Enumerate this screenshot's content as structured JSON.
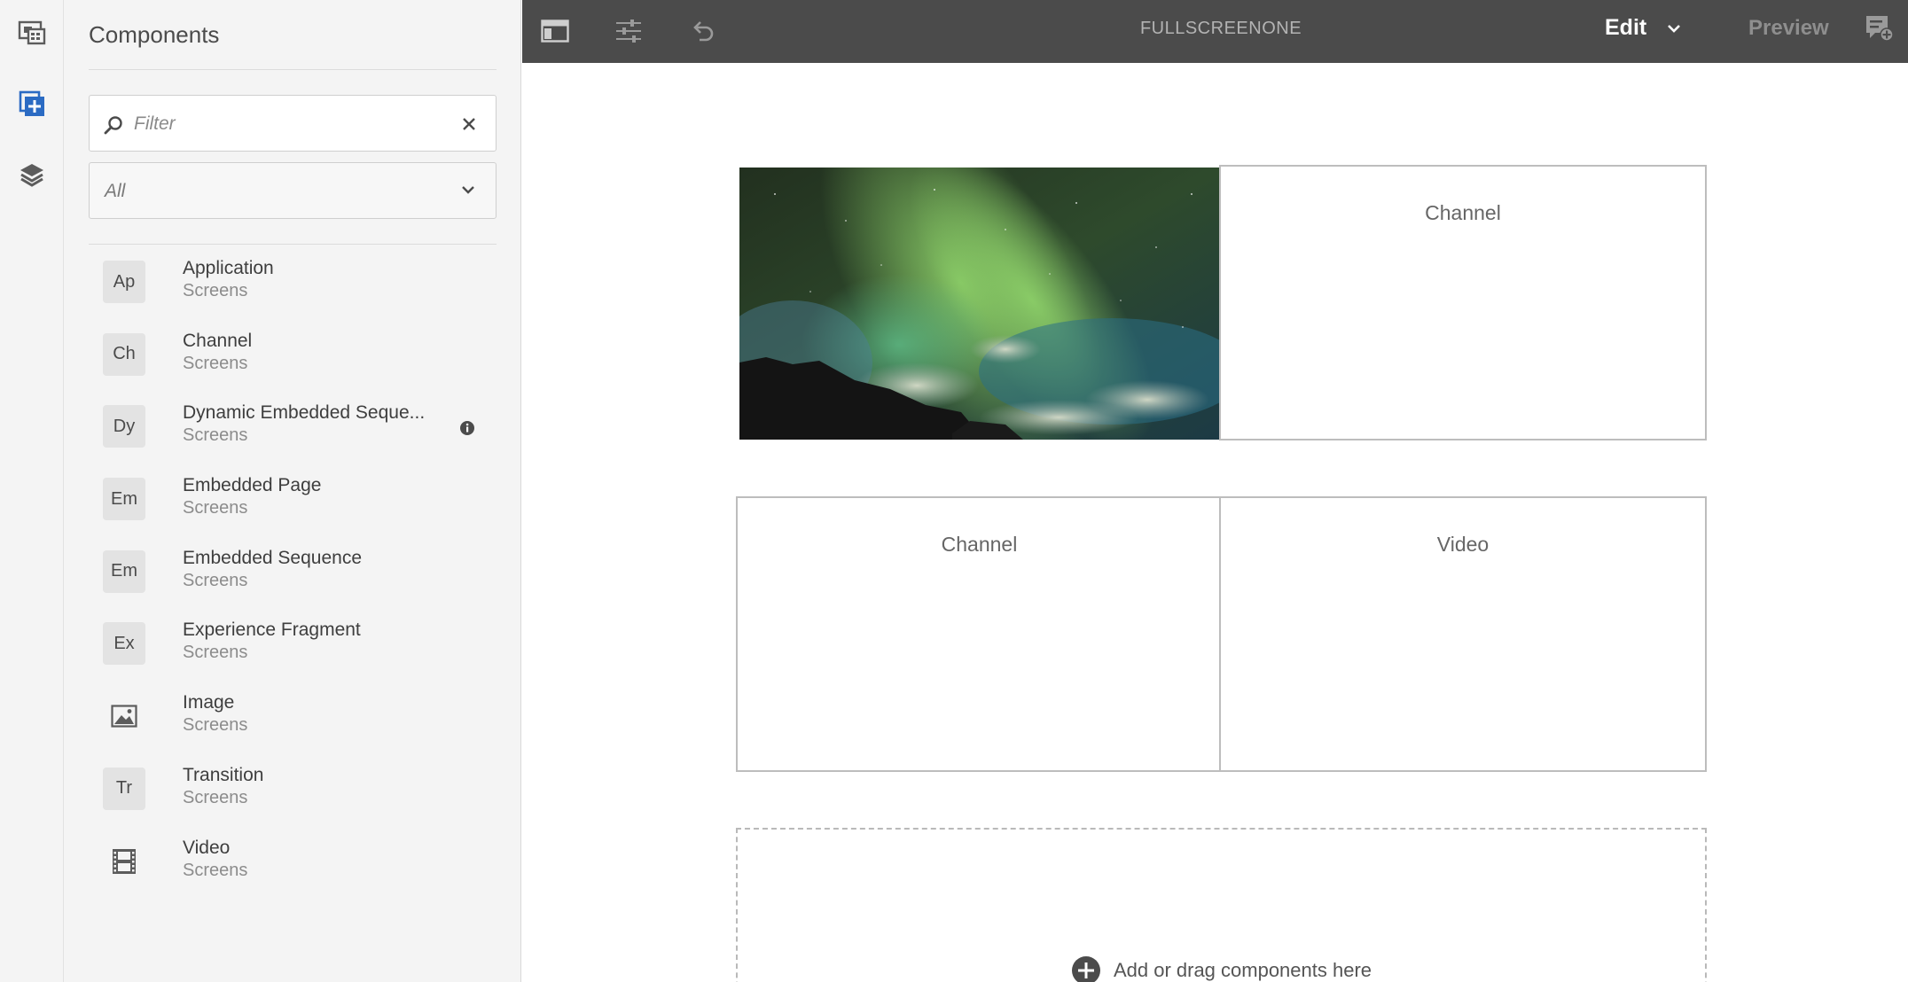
{
  "rail": {
    "items": [
      {
        "icon": "screens-icon"
      },
      {
        "icon": "add-component-icon"
      },
      {
        "icon": "layers-icon"
      }
    ]
  },
  "panel": {
    "title": "Components",
    "filter": {
      "placeholder": "Filter",
      "value": ""
    },
    "group_select": {
      "value": "All"
    },
    "components": [
      {
        "badge": "Ap",
        "name": "Application",
        "group": "Screens"
      },
      {
        "badge": "Ch",
        "name": "Channel",
        "group": "Screens"
      },
      {
        "badge": "Dy",
        "name": "Dynamic Embedded Seque...",
        "group": "Screens",
        "info": true
      },
      {
        "badge": "Em",
        "name": "Embedded Page",
        "group": "Screens"
      },
      {
        "badge": "Em",
        "name": "Embedded Sequence",
        "group": "Screens"
      },
      {
        "badge": "Ex",
        "name": "Experience Fragment",
        "group": "Screens"
      },
      {
        "badge": "",
        "icon": "image-icon",
        "name": "Image",
        "group": "Screens"
      },
      {
        "badge": "Tr",
        "name": "Transition",
        "group": "Screens"
      },
      {
        "badge": "",
        "icon": "film-icon",
        "name": "Video",
        "group": "Screens"
      }
    ]
  },
  "toolbar": {
    "page_name": "FULLSCREENONE",
    "mode": "Edit",
    "preview": "Preview",
    "colors": {
      "background": "#4b4b4b",
      "mode_text": "#ffffff",
      "muted_text": "#8e8e8e"
    }
  },
  "canvas": {
    "image_cell": {
      "alt": "aurora-image"
    },
    "cells": [
      {
        "label": "Channel"
      },
      {
        "label": "Channel"
      },
      {
        "label": "Video"
      }
    ],
    "dropzone": {
      "text": "Add or drag components here"
    }
  }
}
